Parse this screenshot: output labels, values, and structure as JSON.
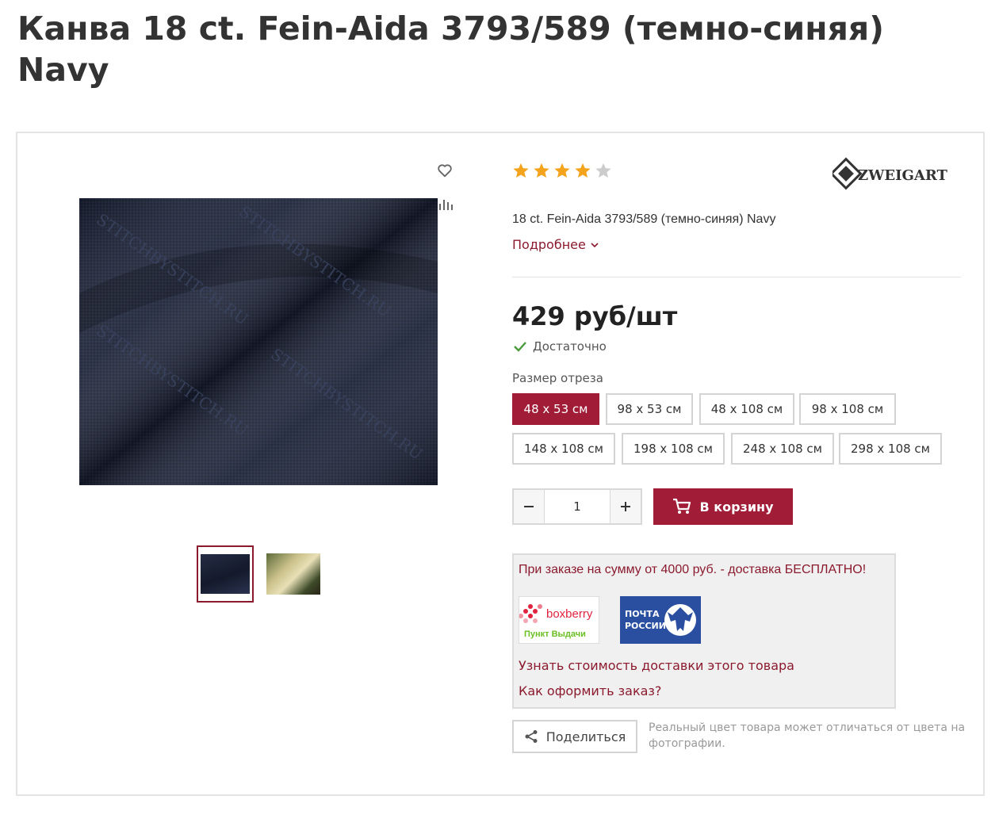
{
  "page": {
    "title": "Канва 18 ct. Fein-Aida 3793/589 (темно-синяя) Navy"
  },
  "gallery": {
    "watermark_text": "STITCHBYSTITCH.RU",
    "thumbnails": [
      "navy-fabric",
      "embroidery-scene"
    ]
  },
  "product": {
    "rating": 4,
    "rating_max": 5,
    "brand": "ZWEIGART",
    "name": "18 ct. Fein-Aida 3793/589 (темно-синяя) Navy",
    "more_label": "Подробнее",
    "price": "429 руб/шт",
    "stock": "Достаточно",
    "size_label": "Размер отреза",
    "sizes": [
      "48 x 53 см",
      "98 x 53 см",
      "48 x 108 см",
      "98 x 108 см",
      "148 x 108 см",
      "198 x 108 см",
      "248 x 108 см",
      "298 x 108 см"
    ],
    "selected_size": "48 x 53 см",
    "quantity": "1",
    "cart_label": "В корзину"
  },
  "delivery": {
    "promo": "При заказе на сумму от 4000 руб. - доставка БЕСПЛАТНО!",
    "boxberry_name": "boxberry",
    "boxberry_sub": "Пункт Выдачи",
    "pochta_line1": "ПОЧТА",
    "pochta_line2": "РОССИИ",
    "cost_link": "Узнать стоимость доставки этого товара",
    "howto_link": "Как оформить заказ?"
  },
  "share": {
    "label": "Поделиться",
    "note": "Реальный цвет товара может отличаться от цвета на фотографии."
  },
  "colors": {
    "accent": "#a01c37",
    "link": "#8b1a2e",
    "star": "#f4a31c",
    "star_empty": "#cccccc",
    "fabric": "#1c2338",
    "check": "#4a9b3a"
  }
}
